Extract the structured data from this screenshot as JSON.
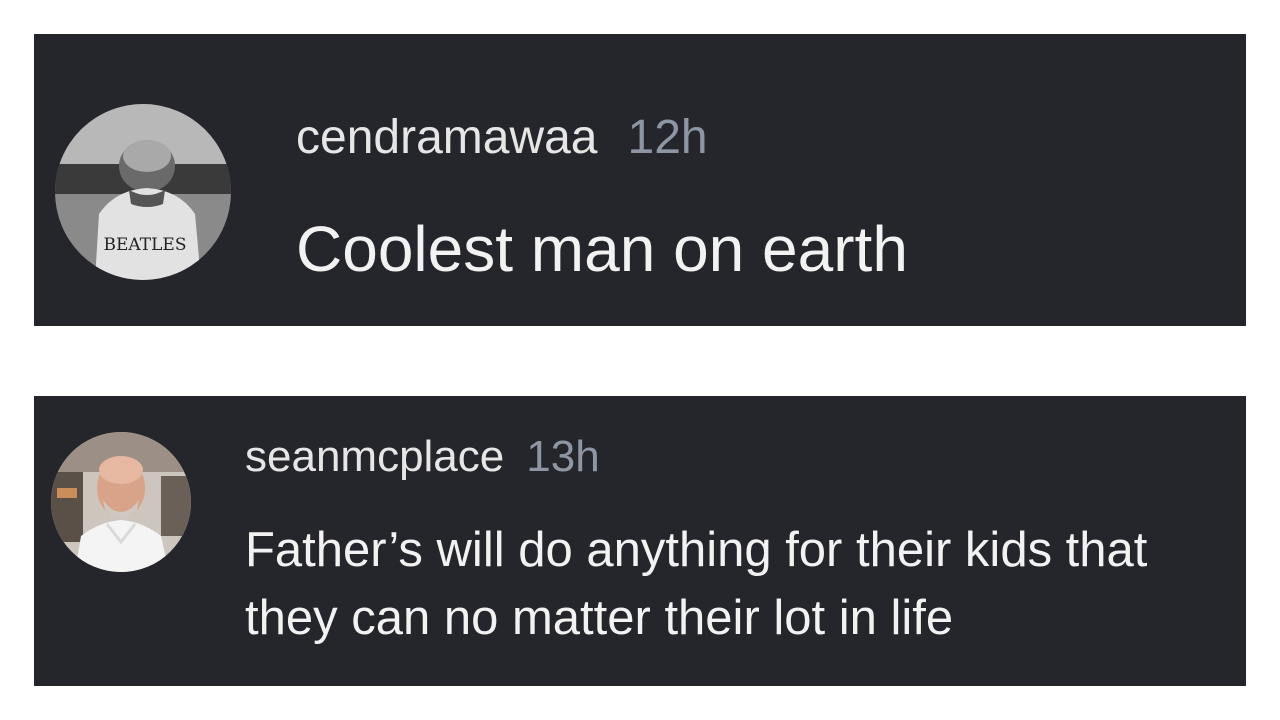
{
  "comments": [
    {
      "username": "cendramawaa",
      "time": "12h",
      "text": "Coolest man on earth",
      "avatar": {
        "icon": "beatles-shirt-avatar-icon",
        "logo_text": "BEATLES"
      }
    },
    {
      "username": "seanmcplace",
      "time": "13h",
      "text": "Father’s will do anything for their kids that they can no matter their lot in life",
      "avatar": {
        "icon": "bald-man-avatar-icon"
      }
    }
  ],
  "colors": {
    "card_background": "#25262b",
    "username": "#e6e6e6",
    "timestamp": "#8f96a3",
    "comment_text": "#f2f2f2"
  }
}
